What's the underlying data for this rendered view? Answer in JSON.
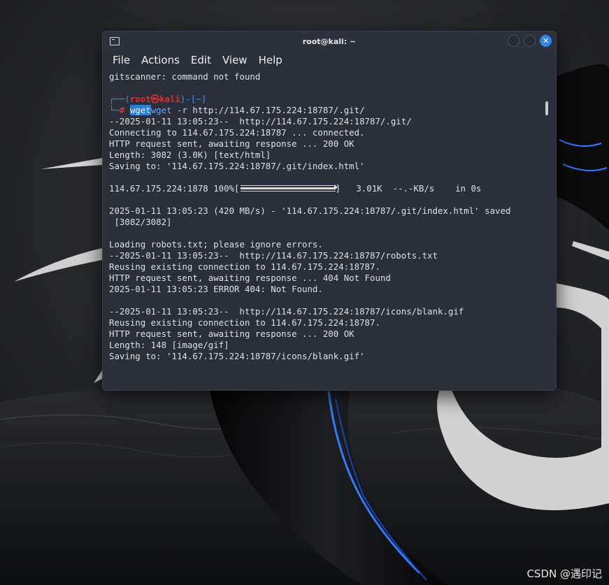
{
  "window": {
    "title": "root@kali: ~",
    "close_glyph": "✕"
  },
  "menu": [
    "File",
    "Actions",
    "Edit",
    "View",
    "Help"
  ],
  "icons": {
    "app": "terminal-icon",
    "close": "close-icon"
  },
  "colors": {
    "accent": "#3584e4",
    "prompt_frame": "#3b8eea",
    "prompt_user": "#e02e2e",
    "terminal_bg": "#2a2f3a"
  },
  "terminal": {
    "lines": [
      [
        {
          "t": "gitscanner: command not found"
        }
      ],
      [],
      [
        {
          "t": "┌──(",
          "c": "frame"
        },
        {
          "t": "root㉿kali",
          "c": "red"
        },
        {
          "t": ")-[",
          "c": "frame"
        },
        {
          "t": "~",
          "c": "frame"
        },
        {
          "t": "]",
          "c": "frame"
        }
      ],
      [
        {
          "t": "└─",
          "c": "frame"
        },
        {
          "t": "# ",
          "c": "red"
        },
        {
          "t": "wget",
          "c": "hl"
        },
        {
          "t": "wget",
          "c": "cmd"
        },
        {
          "t": " -r",
          "c": "flag"
        },
        {
          "t": " http://114.67.175.224:18787/.git/"
        }
      ],
      [
        {
          "t": "--2025-01-11 13:05:23--  http://114.67.175.224:18787/.git/"
        }
      ],
      [
        {
          "t": "Connecting to 114.67.175.224:18787 ... connected."
        }
      ],
      [
        {
          "t": "HTTP request sent, awaiting response ... 200 OK"
        }
      ],
      [
        {
          "t": "Length: 3082 (3.0K) [text/html]"
        }
      ],
      [
        {
          "t": "Saving to: '114.67.175.224:18787/.git/index.html'"
        }
      ],
      [],
      [
        {
          "t": "114.67.175.224:1878 100%["
        },
        {
          "bar": true,
          "fill": 1.0
        },
        {
          "t": "]   3.01K  --.-KB/s    in 0s"
        }
      ],
      [],
      [
        {
          "t": "2025-01-11 13:05:23 (420 MB/s) - '114.67.175.224:18787/.git/index.html' saved"
        }
      ],
      [
        {
          "t": " [3082/3082]"
        }
      ],
      [],
      [
        {
          "t": "Loading robots.txt; please ignore errors."
        }
      ],
      [
        {
          "t": "--2025-01-11 13:05:23--  http://114.67.175.224:18787/robots.txt"
        }
      ],
      [
        {
          "t": "Reusing existing connection to 114.67.175.224:18787."
        }
      ],
      [
        {
          "t": "HTTP request sent, awaiting response ... 404 Not Found"
        }
      ],
      [
        {
          "t": "2025-01-11 13:05:23 ERROR 404: Not Found."
        }
      ],
      [],
      [
        {
          "t": "--2025-01-11 13:05:23--  http://114.67.175.224:18787/icons/blank.gif"
        }
      ],
      [
        {
          "t": "Reusing existing connection to 114.67.175.224:18787."
        }
      ],
      [
        {
          "t": "HTTP request sent, awaiting response ... 200 OK"
        }
      ],
      [
        {
          "t": "Length: 148 [image/gif]"
        }
      ],
      [
        {
          "t": "Saving to: '114.67.175.224:18787/icons/blank.gif'"
        }
      ]
    ]
  },
  "watermark": "CSDN @遇印记"
}
